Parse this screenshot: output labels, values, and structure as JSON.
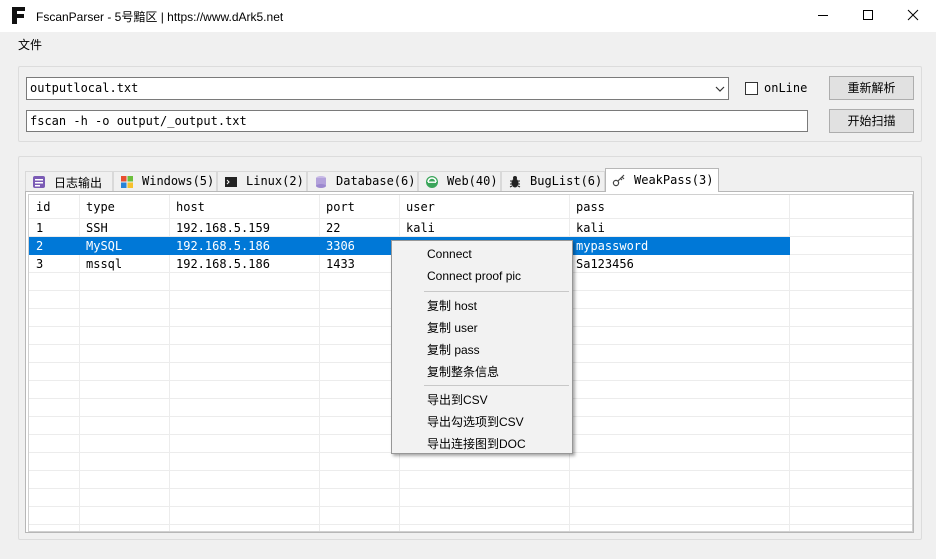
{
  "window": {
    "title": "FscanParser - 5号黯区 | https://www.dArk5.net"
  },
  "menu": {
    "file": "文件"
  },
  "controls": {
    "file_value": "outputlocal.txt",
    "online_label": "onLine",
    "online_checked": false,
    "command_value": "fscan -h -o output/_output.txt",
    "reparse_button": "重新解析",
    "scan_button": "开始扫描"
  },
  "tabs": [
    {
      "label": "日志输出",
      "icon": "log-icon"
    },
    {
      "label": "Windows(5)",
      "icon": "windows-icon"
    },
    {
      "label": "Linux(2)",
      "icon": "terminal-icon"
    },
    {
      "label": "Database(6)",
      "icon": "database-icon"
    },
    {
      "label": "Web(40)",
      "icon": "web-icon"
    },
    {
      "label": "BugList(6)",
      "icon": "bug-icon"
    },
    {
      "label": "WeakPass(3)",
      "icon": "key-icon"
    }
  ],
  "active_tab": "WeakPass(3)",
  "table": {
    "columns": [
      "id",
      "type",
      "host",
      "port",
      "user",
      "pass"
    ],
    "rows": [
      [
        "1",
        "SSH",
        "192.168.5.159",
        "22",
        "kali",
        "kali"
      ],
      [
        "2",
        "MySQL",
        "192.168.5.186",
        "3306",
        "",
        "mypassword"
      ],
      [
        "3",
        "mssql",
        "192.168.5.186",
        "1433",
        "",
        "Sa123456"
      ]
    ],
    "selected_row": 1
  },
  "context_menu": {
    "items": [
      "Connect",
      "Connect proof pic",
      "复制 host",
      "复制 user",
      "复制 pass",
      "复制整条信息",
      "导出到CSV",
      "导出勾选项到CSV",
      "导出连接图到DOC"
    ]
  },
  "colors": {
    "selection": "#0078d7",
    "window_bg": "#f0f0f0"
  }
}
